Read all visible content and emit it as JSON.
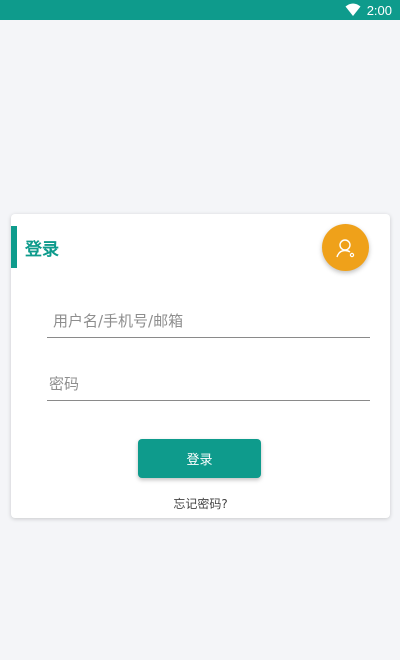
{
  "status_bar": {
    "time": "2:00",
    "wifi_icon": "wifi-icon",
    "background": "#0e9b8c"
  },
  "login_card": {
    "title": "登录",
    "avatar_icon": "user-search-icon",
    "username_placeholder": "用户名/手机号/邮箱",
    "username_value": "",
    "password_placeholder": "密码",
    "password_value": "",
    "login_button_label": "登录",
    "forgot_password_label": "忘记密码?"
  },
  "colors": {
    "accent": "#0e9b8c",
    "avatar_bg": "#efa11a",
    "page_bg": "#f4f5f8"
  }
}
